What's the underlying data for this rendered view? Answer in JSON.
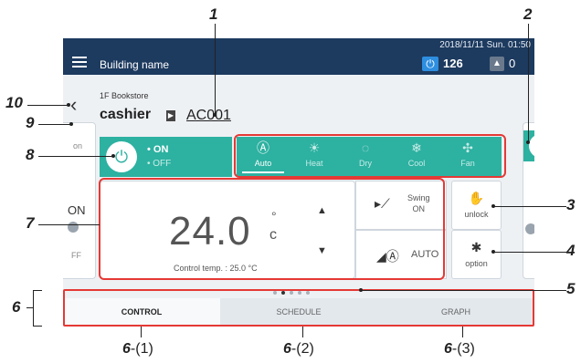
{
  "header": {
    "building_name": "Building name",
    "datetime": "2018/11/11 Sun. 01:50",
    "on_count": "126",
    "alert_count": "0"
  },
  "location": {
    "floor": "1F Bookstore",
    "unit_name": "cashier",
    "unit_id": "AC001"
  },
  "power": {
    "on_label": "• ON",
    "off_label": "• OFF"
  },
  "modes": [
    {
      "label": "Auto",
      "icon": "auto-mode-icon",
      "glyph": "Ⓐ"
    },
    {
      "label": "Heat",
      "icon": "sun-icon",
      "glyph": "☀"
    },
    {
      "label": "Dry",
      "icon": "droplet-icon",
      "glyph": "◌"
    },
    {
      "label": "Cool",
      "icon": "snowflake-icon",
      "glyph": "❄"
    },
    {
      "label": "Fan",
      "icon": "fan-icon",
      "glyph": "✣"
    }
  ],
  "temperature": {
    "value": "24.0",
    "deg": "°",
    "unit": "c",
    "control_temp": "Control temp. : 25.0 °C"
  },
  "swing": {
    "label_line1": "Swing",
    "label_line2": "ON"
  },
  "fan_speed": {
    "label": "AUTO"
  },
  "side_buttons": {
    "unlock": "unlock",
    "option": "option"
  },
  "left_peek": {
    "partial_top": "on",
    "partial_mid": "ON",
    "partial_bottom": "FF"
  },
  "tabs": [
    {
      "label": "CONTROL"
    },
    {
      "label": "SCHEDULE"
    },
    {
      "label": "GRAPH"
    }
  ],
  "callouts": {
    "c1": "1",
    "c2": "2",
    "c3": "3",
    "c4": "4",
    "c5": "5",
    "c6": "6",
    "c7": "7",
    "c8": "8",
    "c9": "9",
    "c10": "10",
    "c6_1": "6",
    "c6_1_suffix": "-(1)",
    "c6_2": "6",
    "c6_2_suffix": "-(2)",
    "c6_3": "6",
    "c6_3_suffix": "-(3)"
  },
  "colors": {
    "accent_teal": "#2db1a1",
    "topbar": "#1d3a5f",
    "highlight_red": "#e53935"
  }
}
